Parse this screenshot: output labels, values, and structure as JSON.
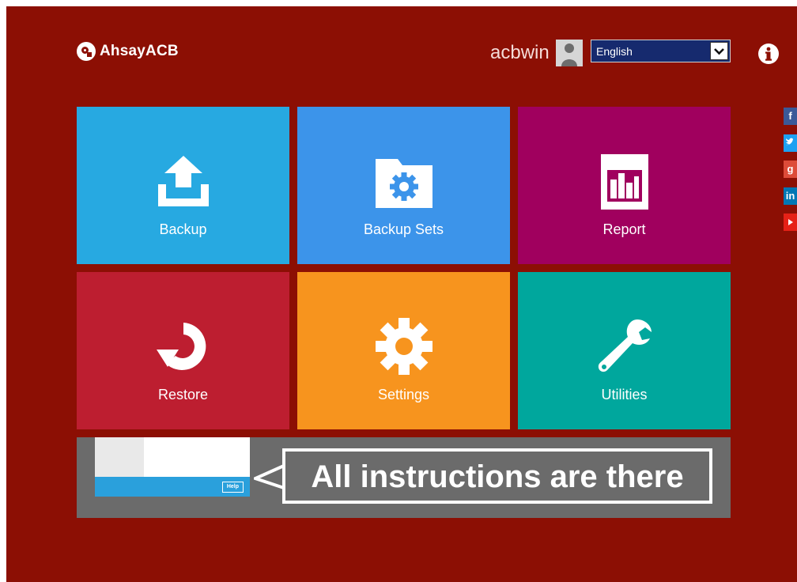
{
  "header": {
    "logo_text": "AhsayACB",
    "username": "acbwin",
    "language": "English"
  },
  "tiles": [
    {
      "label": "Backup",
      "color": "#27a9e1"
    },
    {
      "label": "Backup Sets",
      "color": "#3c94ea"
    },
    {
      "label": "Report",
      "color": "#a0005e"
    },
    {
      "label": "Restore",
      "color": "#bd1e30"
    },
    {
      "label": "Settings",
      "color": "#f7941e"
    },
    {
      "label": "Utilities",
      "color": "#00a79d"
    }
  ],
  "social": [
    "facebook-icon",
    "twitter-icon",
    "google-plus-icon",
    "linkedin-icon",
    "youtube-icon"
  ],
  "banner": {
    "help_label": "Help",
    "text": "All instructions are there"
  }
}
